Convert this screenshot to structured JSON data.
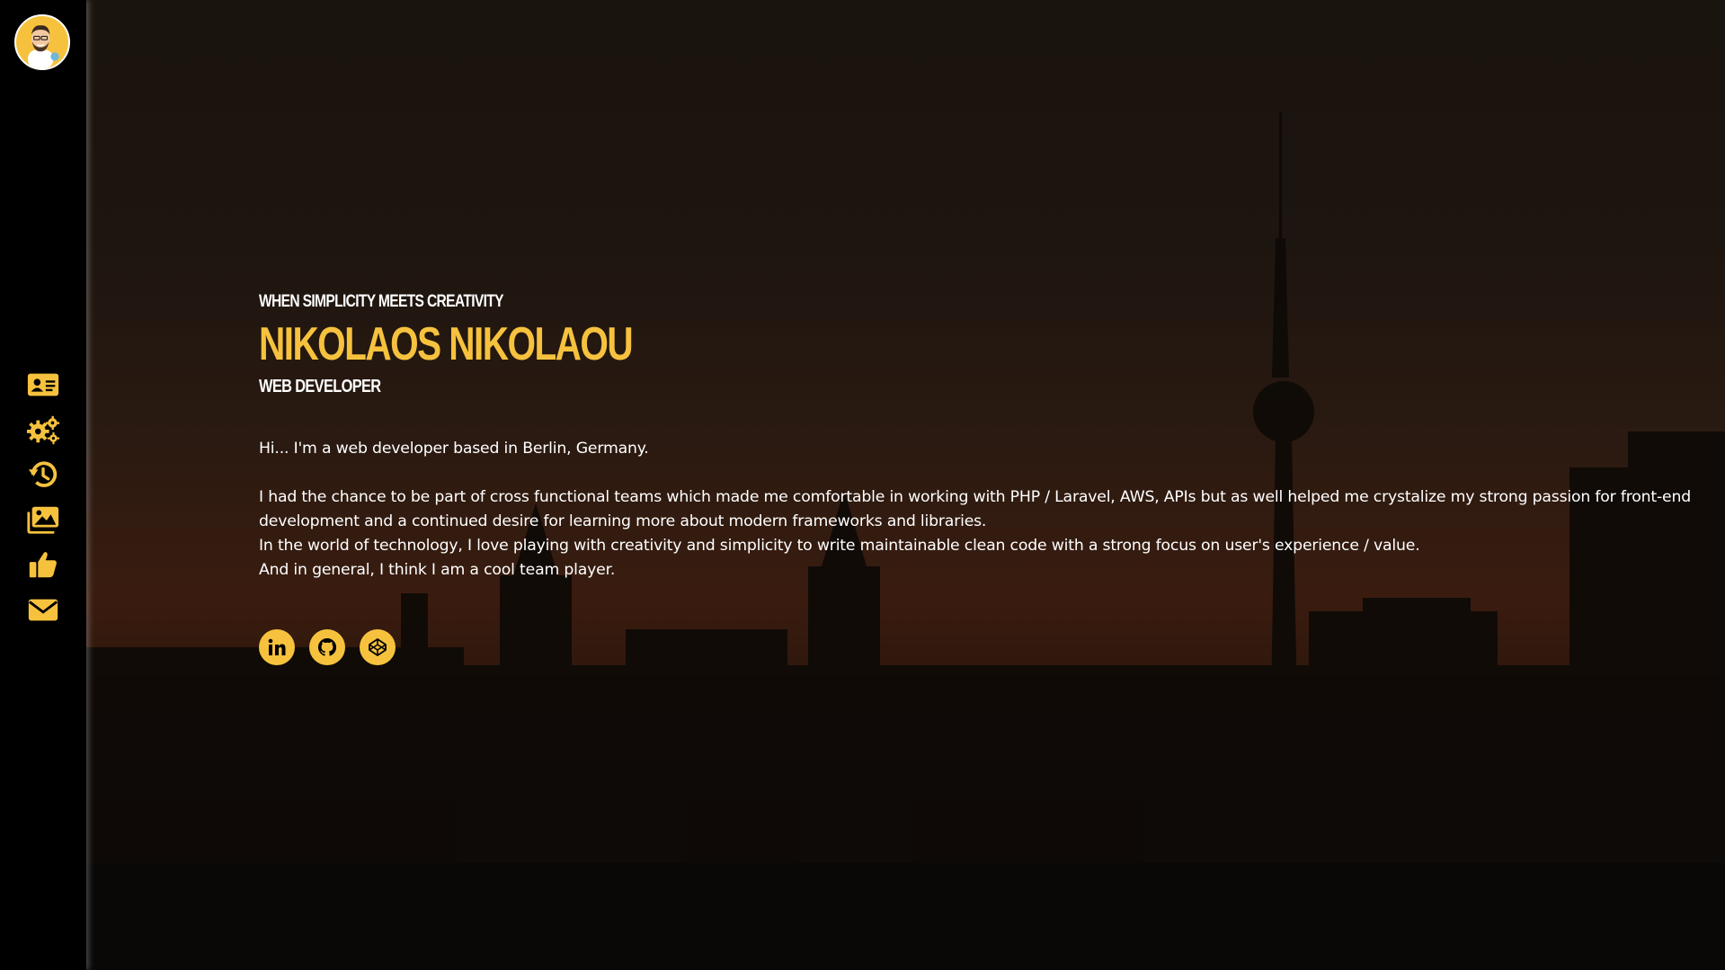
{
  "sidebar": {
    "avatar_alt": "",
    "nav": [
      {
        "icon": "id-card-icon",
        "name": "nav-about"
      },
      {
        "icon": "gears-icon",
        "name": "nav-skills"
      },
      {
        "icon": "history-icon",
        "name": "nav-experience"
      },
      {
        "icon": "images-icon",
        "name": "nav-portfolio"
      },
      {
        "icon": "thumbs-up-icon",
        "name": "nav-recommendations"
      },
      {
        "icon": "envelope-icon",
        "name": "nav-contact"
      }
    ]
  },
  "hero": {
    "tagline": "WHEN SIMPLICITY MEETS CREATIVITY",
    "name": "NIKOLAOS NIKOLAOU",
    "role": "WEB DEVELOPER",
    "bio": {
      "intro": "Hi... I'm a web developer based in Berlin, Germany.",
      "p1": "I had the chance to be part of cross functional teams which made me comfortable in working with PHP / Laravel, AWS, APIs but as well helped me crystalize my strong passion for front-end development and a continued desire for learning more about modern frameworks and libraries.",
      "p2": "In the world of technology, I love playing with creativity and simplicity to write maintainable clean code with a strong focus on user's experience / value.",
      "p3": "And in general, I think I am a cool team player."
    },
    "social": [
      {
        "icon": "linkedin-icon"
      },
      {
        "icon": "github-icon"
      },
      {
        "icon": "codepen-icon"
      }
    ]
  },
  "colors": {
    "accent": "#f6c23e",
    "sidebar_bg": "#000000",
    "text": "#ffffff"
  }
}
